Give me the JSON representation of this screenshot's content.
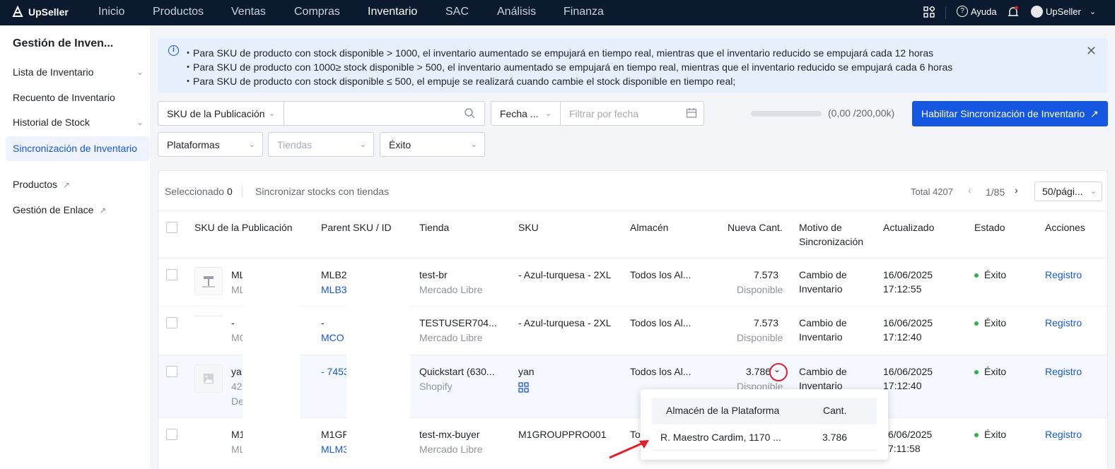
{
  "topnav": {
    "brand": "UpSeller",
    "items": [
      "Inicio",
      "Productos",
      "Ventas",
      "Compras",
      "Inventario",
      "SAC",
      "Análisis",
      "Finanza"
    ],
    "active": "Inventario",
    "help": "Ayuda",
    "account": "UpSeller"
  },
  "sidebar": {
    "title": "Gestión de Inven...",
    "items": [
      {
        "label": "Lista de Inventario"
      },
      {
        "label": "Recuento de Inventario"
      },
      {
        "label": "Historial de Stock"
      },
      {
        "label": "Sincronización de Inventario"
      },
      {
        "label": "Productos"
      },
      {
        "label": "Gestión de Enlace"
      }
    ]
  },
  "notice": {
    "lines": [
      "・Para SKU de producto con stock disponible > 1000, el inventario aumentado se empujará en tiempo real, mientras que el inventario reducido se empujará cada 12 horas",
      "・Para SKU de producto con 1000≥ stock disponible > 500, el inventario aumentado se empujará en tiempo real, mientras que el inventario reducido se empujará cada 6 horas",
      "・Para SKU de producto con stock disponible ≤ 500, el empuje se realizará cuando cambie el stock disponible en tiempo real;"
    ]
  },
  "filters": {
    "sku_select": "SKU de la Publicación",
    "date_select": "Fecha ...",
    "date_placeholder": "Filtrar por fecha",
    "platforms": "Plataformas",
    "stores": "Tiendas",
    "status": "Éxito"
  },
  "progress": {
    "label": "(0,00 /200,00k)",
    "fraction": 0
  },
  "enable_button": "Habilitar Sincronización de Inventario",
  "toolbar": {
    "selected_label": "Seleccionado",
    "selected_count": "0",
    "sync_label": "Sincronizar stocks con tiendas",
    "total": "Total 4207",
    "page": "1/85",
    "page_size": "50/pági..."
  },
  "table": {
    "headers": {
      "sku_pub": "SKU de la Publicación",
      "parent": "Parent SKU / ID",
      "store": "Tienda",
      "sku": "SKU",
      "warehouse": "Almacén",
      "new_qty": "Nueva Cant.",
      "reason_1": "Motivo de",
      "reason_2": "Sincronización",
      "updated": "Actualizado",
      "status": "Estado",
      "actions": "Acciones"
    },
    "rows": [
      {
        "pub1": "ML",
        "pub2": "ML",
        "parent1": "MLB2",
        "parent2": "MLB3",
        "store": "test-br",
        "platform": "Mercado Libre",
        "sku": "- Azul-turquesa - 2XL",
        "warehouse": "Todos los Al...",
        "qty": "7.573",
        "qty_sub": "Disponible",
        "reason1": "Cambio de",
        "reason2": "Inventario",
        "date": "16/06/2025",
        "time": "17:12:55",
        "status": "Éxito",
        "action": "Registro"
      },
      {
        "pub1": "-",
        "pub2": "MC",
        "parent1": "-",
        "parent2": "MCO",
        "store": "TESTUSER704...",
        "platform": "Mercado Libre",
        "sku": "- Azul-turquesa - 2XL",
        "warehouse": "Todos los Al...",
        "qty": "7.573",
        "qty_sub": "Disponible",
        "reason1": "Cambio de",
        "reason2": "Inventario",
        "date": "16/06/2025",
        "time": "17:12:40",
        "status": "Éxito",
        "action": "Registro"
      },
      {
        "pub1": "ya",
        "pub2": "42",
        "pub3": "De",
        "parent1": "- 7453",
        "store": "Quickstart (630...",
        "platform": "Shopify",
        "sku": "yan",
        "warehouse": "Todos los Al...",
        "qty": "3.786",
        "qty_sub": "Disponible",
        "reason1": "Cambio de",
        "reason2": "Inventario",
        "date": "16/06/2025",
        "time": "17:12:40",
        "status": "Éxito",
        "action": "Registro"
      },
      {
        "pub1": "M1",
        "pub2": "ML",
        "parent1": "M1GF",
        "parent2": "MLM3",
        "store": "test-mx-buyer",
        "platform": "Mercado Libre",
        "sku": "M1GROUPPRO001",
        "warehouse": "To",
        "qty": "",
        "qty_sub": "",
        "reason1": "",
        "reason2": "",
        "date": "6/06/2025",
        "time": "7:11:58",
        "status": "Éxito",
        "action": "Registro"
      }
    ]
  },
  "popup": {
    "col1": "Almacén de la Plataforma",
    "col2": "Cant.",
    "warehouse": "R. Maestro Cardim, 1170 ...",
    "qty": "3.786"
  },
  "colors": {
    "nav_bg": "#0b1a2e",
    "accent": "#1557e0",
    "success": "#2fb344",
    "highlight": "#e0202a"
  }
}
